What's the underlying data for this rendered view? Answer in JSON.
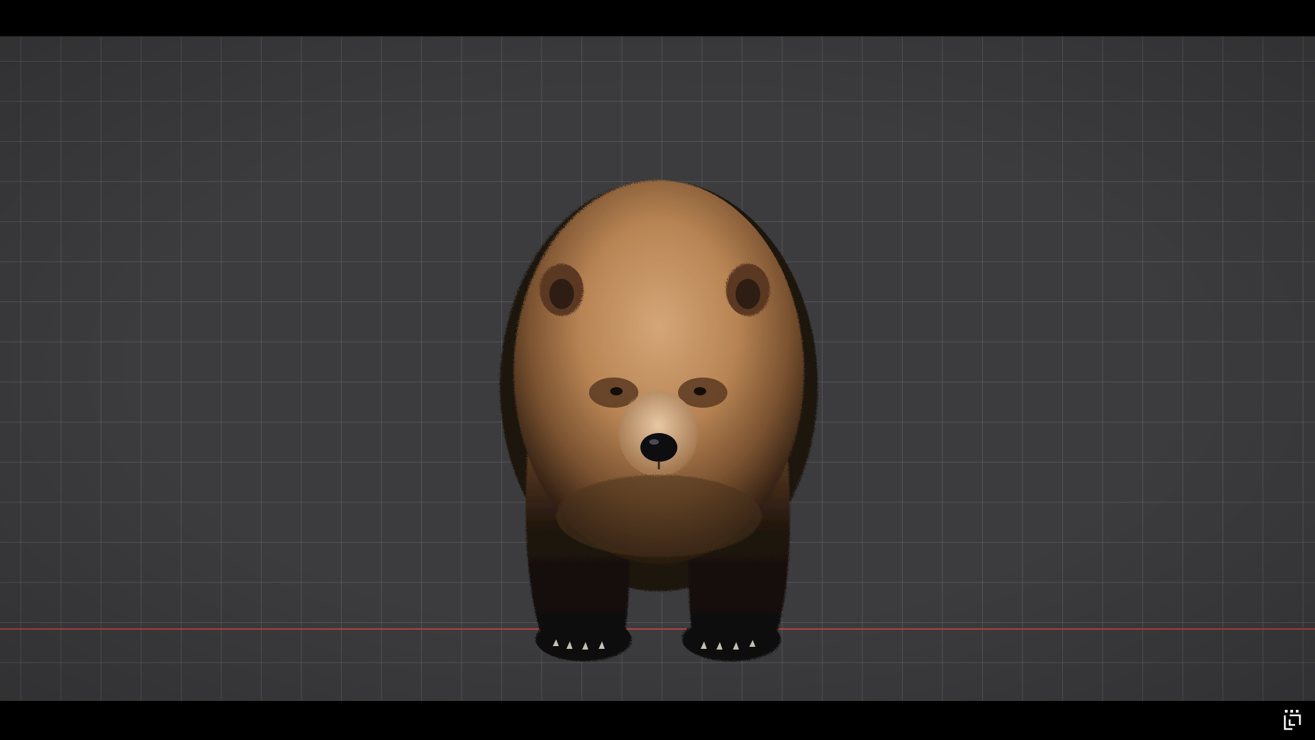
{
  "viewport": {
    "background_color": "#3c3c3e",
    "grid_color": "#57575a",
    "axis_color": "#b8423f",
    "model": "bear-model",
    "view": "front-orthographic"
  },
  "watermark": {
    "icon": "channel-logo-icon",
    "color": "#ffffff"
  }
}
